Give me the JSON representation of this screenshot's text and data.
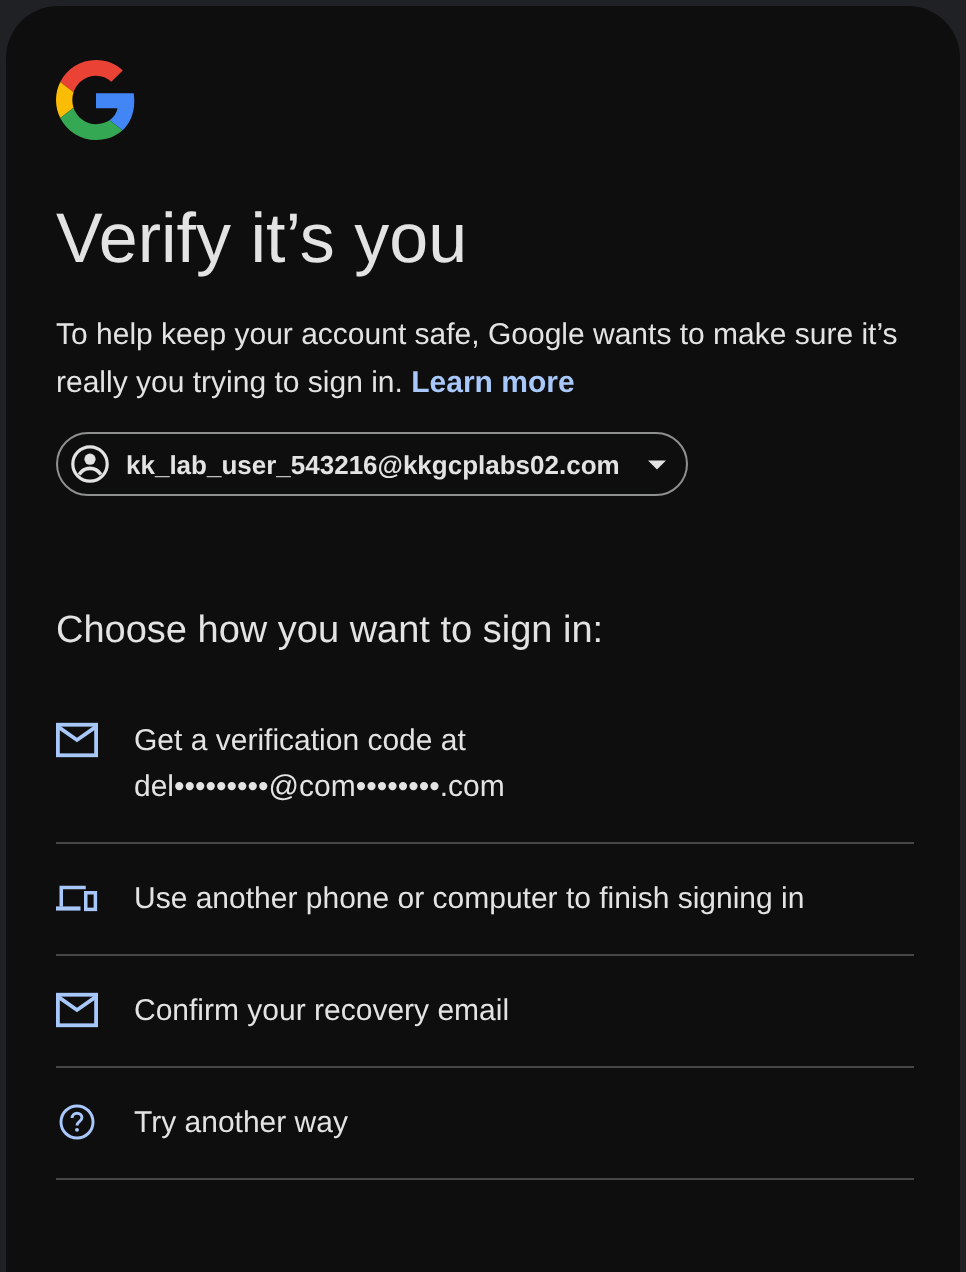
{
  "title": "Verify it’s you",
  "description": "To help keep your account safe, Google wants to make sure it’s really you trying to sign in.",
  "learn_more": "Learn more",
  "account": {
    "email": "kk_lab_user_543216@kkgcplabs02.com"
  },
  "heading": "Choose how you want to sign in:",
  "options": [
    {
      "kind": "email",
      "lines": [
        "Get a verification code at",
        "del•••••••••@com••••••••.com"
      ]
    },
    {
      "kind": "devices",
      "lines": [
        "Use another phone or computer to finish signing in"
      ]
    },
    {
      "kind": "email",
      "lines": [
        "Confirm your recovery email"
      ]
    },
    {
      "kind": "help",
      "lines": [
        "Try another way"
      ]
    }
  ]
}
